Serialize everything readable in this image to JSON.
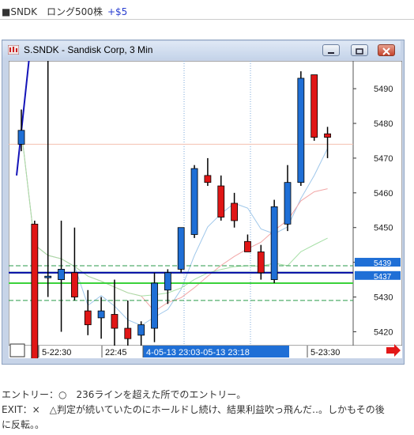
{
  "header": {
    "text": "■SNDK　ロング500株",
    "pl": "+$5"
  },
  "window": {
    "title": "S.SNDK - Sandisk Corp, 3 Min"
  },
  "chart_data": {
    "type": "candlestick",
    "y_ticks": [
      5420,
      5430,
      5440,
      5450,
      5460,
      5470,
      5480,
      5490
    ],
    "ylim": [
      5416,
      5498
    ],
    "x_labels": [
      "5-22:30",
      "22:45",
      "4-05-13 23:03-05-13 23:18",
      "5-23:30"
    ],
    "price_tags": [
      "5439",
      "5437"
    ],
    "candles": [
      {
        "o": 5474,
        "h": 5484,
        "l": 5472,
        "c": 5478
      },
      {
        "o": 5451,
        "h": 5452,
        "l": 5412,
        "c": 5412
      },
      {
        "o": 5436,
        "h": 5540,
        "l": 5430,
        "c": 5436
      },
      {
        "o": 5435,
        "h": 5452,
        "l": 5420,
        "c": 5438
      },
      {
        "o": 5437,
        "h": 5450,
        "l": 5429,
        "c": 5430
      },
      {
        "o": 5426,
        "h": 5432,
        "l": 5419,
        "c": 5422
      },
      {
        "o": 5424,
        "h": 5430,
        "l": 5418,
        "c": 5426
      },
      {
        "o": 5425,
        "h": 5435,
        "l": 5416,
        "c": 5421
      },
      {
        "o": 5421,
        "h": 5429,
        "l": 5416,
        "c": 5418
      },
      {
        "o": 5419,
        "h": 5423,
        "l": 5416,
        "c": 5422
      },
      {
        "o": 5421,
        "h": 5437,
        "l": 5417,
        "c": 5434
      },
      {
        "o": 5432,
        "h": 5438,
        "l": 5428,
        "c": 5437
      },
      {
        "o": 5438,
        "h": 5450,
        "l": 5437,
        "c": 5450
      },
      {
        "o": 5448,
        "h": 5468,
        "l": 5447,
        "c": 5467
      },
      {
        "o": 5465,
        "h": 5470,
        "l": 5462,
        "c": 5463
      },
      {
        "o": 5462,
        "h": 5465,
        "l": 5452,
        "c": 5453
      },
      {
        "o": 5457,
        "h": 5460,
        "l": 5450,
        "c": 5452
      },
      {
        "o": 5446,
        "h": 5448,
        "l": 5443,
        "c": 5443
      },
      {
        "o": 5443,
        "h": 5445,
        "l": 5435,
        "c": 5437
      },
      {
        "o": 5435,
        "h": 5458,
        "l": 5434,
        "c": 5456
      },
      {
        "o": 5451,
        "h": 5468,
        "l": 5449,
        "c": 5463
      },
      {
        "o": 5463,
        "h": 5495,
        "l": 5462,
        "c": 5493
      },
      {
        "o": 5494,
        "h": 5494,
        "l": 5475,
        "c": 5476
      },
      {
        "o": 5477,
        "h": 5479,
        "l": 5470,
        "c": 5476
      }
    ],
    "bull_color": "#1f6fd6",
    "bear_color": "#e01616",
    "reference_lines": [
      {
        "price": 5439,
        "color": "#2a9a4a",
        "style": "dashed"
      },
      {
        "price": 5437,
        "color": "#3bd23b",
        "style": "solid"
      },
      {
        "price": 5434,
        "color": "#3bd23b",
        "style": "solid"
      },
      {
        "price": 5429,
        "color": "#2a9a4a",
        "style": "dashed"
      },
      {
        "price": 5437,
        "color": "#0000aa",
        "style": "solid"
      }
    ]
  },
  "notes": {
    "entry": "エントリー：○　236ラインを超えた所でのエントリー。",
    "exit_line1": "EXIT：×　△判定が続いていたのにホールドし続け、結果利益吹っ飛んだ‥。しかもその後",
    "exit_line2": "に反転。。"
  }
}
